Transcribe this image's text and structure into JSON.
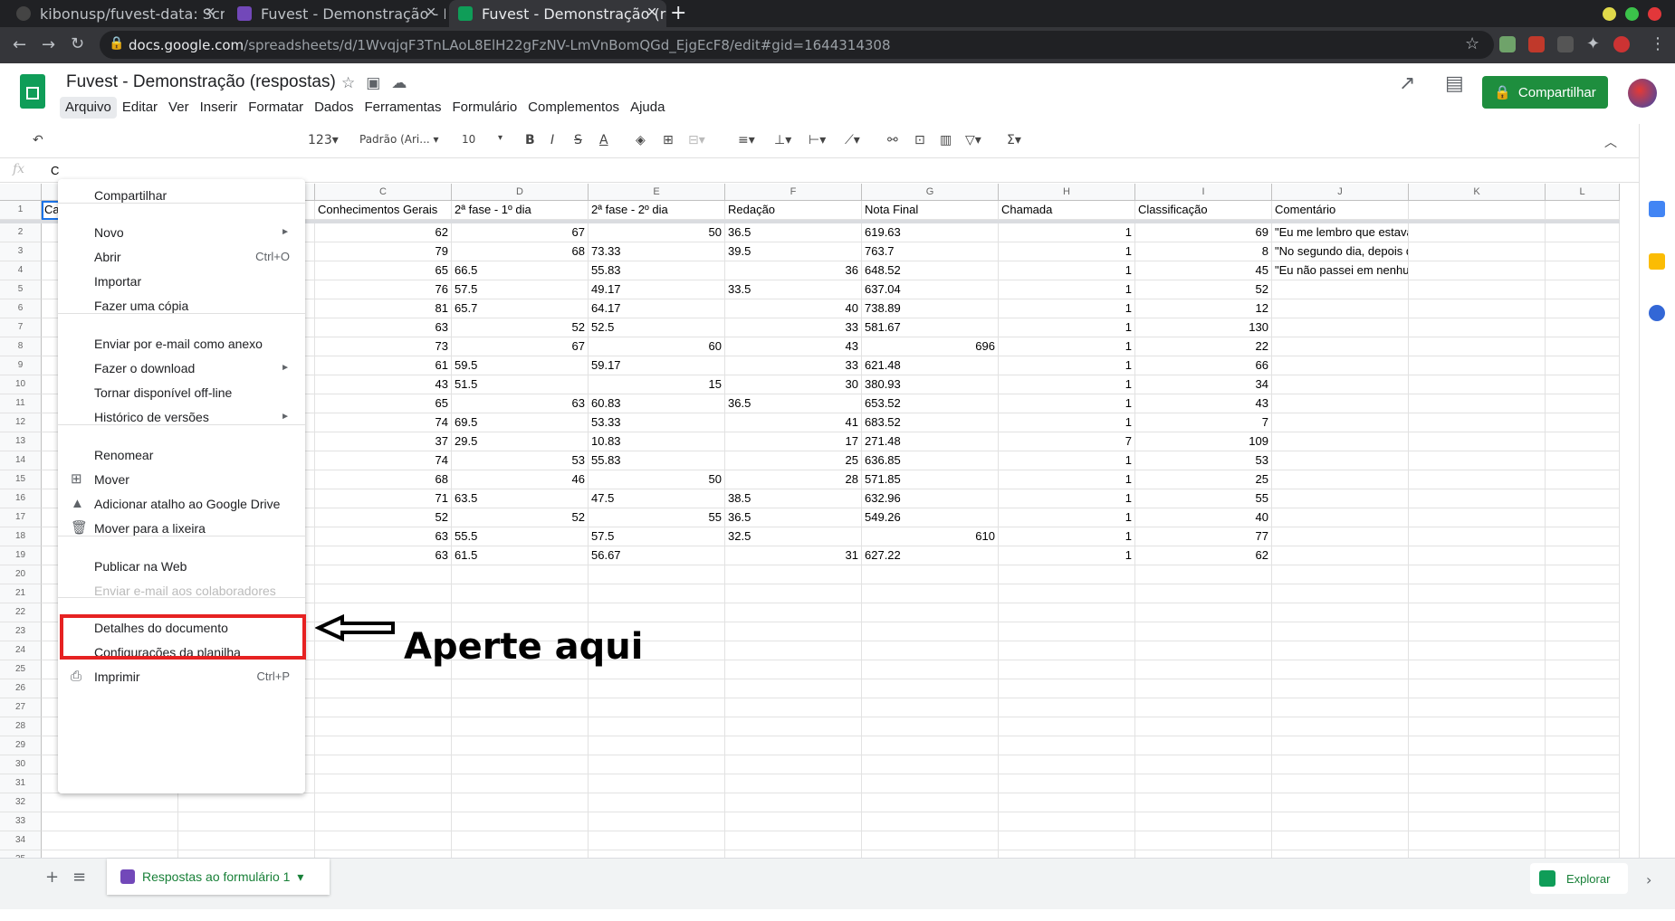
{
  "browser": {
    "tabs": [
      {
        "title": "kibonusp/fuvest-data: Scr"
      },
      {
        "title": "Fuvest - Demonstração - F"
      },
      {
        "title": "Fuvest - Demonstração (re"
      }
    ],
    "url_host": "docs.google.com",
    "url_path": "/spreadsheets/d/1WvqjqF3TnLAoL8ElH22gFzNV-LmVnBomQGd_EjgEcF8/edit#gid=1644314308"
  },
  "doc": {
    "title": "Fuvest - Demonstração (respostas)",
    "menus": [
      "Arquivo",
      "Editar",
      "Ver",
      "Inserir",
      "Formatar",
      "Dados",
      "Ferramentas",
      "Formulário",
      "Complementos",
      "Ajuda"
    ],
    "share_label": "Compartilhar"
  },
  "toolbar": {
    "format": "123",
    "font": "Padrão (Ari...",
    "size": "10"
  },
  "fx": {
    "label": "fx",
    "value": "C"
  },
  "file_menu": {
    "items": [
      {
        "label": "Compartilhar"
      },
      {
        "label": "Novo",
        "submenu": true
      },
      {
        "label": "Abrir",
        "shortcut": "Ctrl+O"
      },
      {
        "label": "Importar"
      },
      {
        "label": "Fazer uma cópia"
      },
      {
        "label": "Enviar por e-mail como anexo"
      },
      {
        "label": "Fazer o download",
        "submenu": true
      },
      {
        "label": "Tornar disponível off-line"
      },
      {
        "label": "Histórico de versões",
        "submenu": true
      },
      {
        "label": "Renomear"
      },
      {
        "label": "Mover"
      },
      {
        "label": "Adicionar atalho ao Google Drive"
      },
      {
        "label": "Mover para a lixeira"
      },
      {
        "label": "Publicar na Web"
      },
      {
        "label": "Enviar e-mail aos colaboradores",
        "disabled": true
      },
      {
        "label": "Detalhes do documento"
      },
      {
        "label": "Configurações da planilha"
      },
      {
        "label": "Imprimir",
        "shortcut": "Ctrl+P"
      }
    ]
  },
  "annotation": {
    "text": "Aperte aqui"
  },
  "sheet": {
    "columns": [
      "C",
      "D",
      "E",
      "F",
      "G",
      "H",
      "I",
      "J",
      "K",
      "L"
    ],
    "header": [
      "Conhecimentos Gerais",
      "2ª fase - 1º dia",
      "2ª fase - 2º dia",
      "Redação",
      "Nota Final",
      "Chamada",
      "Classificação",
      "Comentário",
      "",
      ""
    ],
    "a1": "Ca",
    "rows": [
      [
        "62",
        "67",
        "50",
        "36.5",
        "619.63",
        "1",
        "69",
        "\"Eu me lembro que estava muito nervoso pq estudei somente se"
      ],
      [
        "79",
        "68",
        "73.33",
        "39.5",
        "763.7",
        "1",
        "8",
        "\"No segundo dia, depois da prova de específicas, eu me senti mu"
      ],
      [
        "65",
        "66.5",
        "55.83",
        "36",
        "648.52",
        "1",
        "45",
        "\"Eu não passei em nenhuma chamada na USP, logo eu já estava"
      ],
      [
        "76",
        "57.5",
        "49.17",
        "33.5",
        "637.04",
        "1",
        "52",
        ""
      ],
      [
        "81",
        "65.7",
        "64.17",
        "40",
        "738.89",
        "1",
        "12",
        ""
      ],
      [
        "63",
        "52",
        "52.5",
        "33",
        "581.67",
        "1",
        "130",
        ""
      ],
      [
        "73",
        "67",
        "60",
        "43",
        "696",
        "1",
        "22",
        ""
      ],
      [
        "61",
        "59.5",
        "59.17",
        "33",
        "621.48",
        "1",
        "66",
        ""
      ],
      [
        "43",
        "51.5",
        "15",
        "30",
        "380.93",
        "1",
        "34",
        ""
      ],
      [
        "65",
        "63",
        "60.83",
        "36.5",
        "653.52",
        "1",
        "43",
        ""
      ],
      [
        "74",
        "69.5",
        "53.33",
        "41",
        "683.52",
        "1",
        "7",
        ""
      ],
      [
        "37",
        "29.5",
        "10.83",
        "17",
        "271.48",
        "7",
        "109",
        ""
      ],
      [
        "74",
        "53",
        "55.83",
        "25",
        "636.85",
        "1",
        "53",
        ""
      ],
      [
        "68",
        "46",
        "50",
        "28",
        "571.85",
        "1",
        "25",
        ""
      ],
      [
        "71",
        "63.5",
        "47.5",
        "38.5",
        "632.96",
        "1",
        "55",
        ""
      ],
      [
        "52",
        "52",
        "55",
        "36.5",
        "549.26",
        "1",
        "40",
        ""
      ],
      [
        "63",
        "55.5",
        "57.5",
        "32.5",
        "610",
        "1",
        "77",
        ""
      ],
      [
        "63",
        "61.5",
        "56.67",
        "31",
        "627.22",
        "1",
        "62",
        ""
      ]
    ]
  },
  "bottom": {
    "sheet_tab": "Respostas ao formulário 1",
    "explore": "Explorar"
  }
}
